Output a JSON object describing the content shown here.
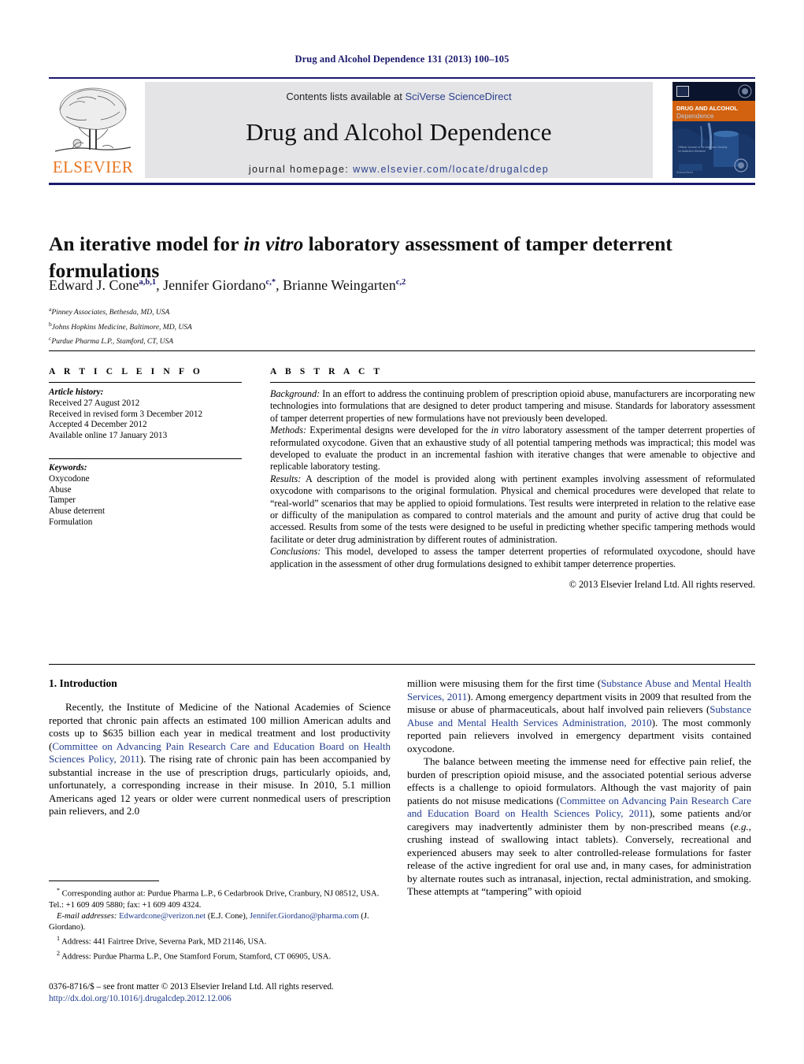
{
  "running_head": "Drug and Alcohol Dependence 131 (2013) 100–105",
  "masthead": {
    "contents_prefix": "Contents lists available at ",
    "contents_link": "SciVerse ScienceDirect",
    "journal_name": "Drug and Alcohol Dependence",
    "homepage_label": "journal homepage: ",
    "homepage_url": "www.elsevier.com/locate/drugalcdep",
    "publisher_name": "ELSEVIER",
    "cover_title_line1": "DRUG AND ALCOHOL",
    "cover_title_line2": "Dependence",
    "accent_orange": "#E87722",
    "accent_navy": "#1a1a6e",
    "link_blue": "#2b3f8c"
  },
  "article": {
    "title_part1": "An iterative model for ",
    "title_italic": "in vitro",
    "title_part2": " laboratory assessment of tamper deterrent formulations",
    "authors": [
      {
        "name": "Edward J. Cone",
        "sup": "a,b,1"
      },
      {
        "name": "Jennifer Giordano",
        "sup": "c,*"
      },
      {
        "name": "Brianne Weingarten",
        "sup": "c,2"
      }
    ],
    "affiliations": [
      {
        "marker": "a",
        "text": "Pinney Associates, Bethesda, MD, USA"
      },
      {
        "marker": "b",
        "text": "Johns Hopkins Medicine, Baltimore, MD, USA"
      },
      {
        "marker": "c",
        "text": "Purdue Pharma L.P., Stamford, CT, USA"
      }
    ]
  },
  "article_info": {
    "heading": "A R T I C L E   I N F O",
    "history_label": "Article history:",
    "history": [
      "Received 27 August 2012",
      "Received in revised form 3 December 2012",
      "Accepted 4 December 2012",
      "Available online 17 January 2013"
    ],
    "keywords_label": "Keywords:",
    "keywords": [
      "Oxycodone",
      "Abuse",
      "Tamper",
      "Abuse deterrent",
      "Formulation"
    ]
  },
  "abstract": {
    "heading": "A B S T R A C T",
    "background_label": "Background:",
    "background_text": " In an effort to address the continuing problem of prescription opioid abuse, manufacturers are incorporating new technologies into formulations that are designed to deter product tampering and misuse. Standards for laboratory assessment of tamper deterrent properties of new formulations have not previously been developed.",
    "methods_label": "Methods:",
    "methods_text_1": " Experimental designs were developed for the ",
    "methods_italic": "in vitro",
    "methods_text_2": " laboratory assessment of the tamper deterrent properties of reformulated oxycodone. Given that an exhaustive study of all potential tampering methods was impractical; this model was developed to evaluate the product in an incremental fashion with iterative changes that were amenable to objective and replicable laboratory testing.",
    "results_label": "Results:",
    "results_text": " A description of the model is provided along with pertinent examples involving assessment of reformulated oxycodone with comparisons to the original formulation. Physical and chemical procedures were developed that relate to “real-world” scenarios that may be applied to opioid formulations. Test results were interpreted in relation to the relative ease or difficulty of the manipulation as compared to control materials and the amount and purity of active drug that could be accessed. Results from some of the tests were designed to be useful in predicting whether specific tampering methods would facilitate or deter drug administration by different routes of administration.",
    "conclusions_label": "Conclusions:",
    "conclusions_text": " This model, developed to assess the tamper deterrent properties of reformulated oxycodone, should have application in the assessment of other drug formulations designed to exhibit tamper deterrence properties.",
    "copyright": "© 2013 Elsevier Ireland Ltd. All rights reserved."
  },
  "body": {
    "section_heading": "1. Introduction",
    "left_p1_a": "Recently, the Institute of Medicine of the National Academies of Science reported that chronic pain affects an estimated 100 million American adults and costs up to $635 billion each year in medical treatment and lost productivity (",
    "left_p1_ref1": "Committee on Advancing Pain Research Care and Education Board on Health Sciences Policy, 2011",
    "left_p1_b": "). The rising rate of chronic pain has been accompanied by substantial increase in the use of prescription drugs, particularly opioids, and, unfortunately, a corresponding increase in their misuse. In 2010, 5.1 million Americans aged 12 years or older were current nonmedical users of prescription pain relievers, and 2.0",
    "right_p1_a": "million were misusing them for the first time (",
    "right_p1_ref1": "Substance Abuse and Mental Health Services, 2011",
    "right_p1_b": "). Among emergency department visits in 2009 that resulted from the misuse or abuse of pharmaceuticals, about half involved pain relievers (",
    "right_p1_ref2": "Substance Abuse and Mental Health Services Administration, 2010",
    "right_p1_c": "). The most commonly reported pain relievers involved in emergency department visits contained oxycodone.",
    "right_p2_a": "The balance between meeting the immense need for effective pain relief, the burden of prescription opioid misuse, and the associated potential serious adverse effects is a challenge to opioid formulators. Although the vast majority of pain patients do not misuse medications (",
    "right_p2_ref1": "Committee on Advancing Pain Research Care and Education Board on Health Sciences Policy, 2011",
    "right_p2_b": "), some patients and/or caregivers may inadvertently administer them by non-prescribed means (",
    "right_p2_italic": "e.g.",
    "right_p2_c": ", crushing instead of swallowing intact tablets). Conversely, recreational and experienced abusers may seek to alter controlled-release formulations for faster release of the active ingredient for oral use and, in many cases, for administration by alternate routes such as intranasal, injection, rectal administration, and smoking. These attempts at “tampering” with opioid"
  },
  "footnotes": {
    "corresponding_marker": "*",
    "corresponding_text": " Corresponding author at: Purdue Pharma L.P., 6 Cedarbrook Drive, Cranbury, NJ 08512, USA. Tel.: +1 609 409 5880; fax: +1 609 409 4324.",
    "email_label": "E-mail addresses:",
    "email_1": "Edwardcone@verizon.net",
    "email_1_who": " (E.J. Cone),",
    "email_2": "Jennifer.Giordano@pharma.com",
    "email_2_who": " (J. Giordano).",
    "note1_marker": "1",
    "note1_text": " Address: 441 Fairtree Drive, Severna Park, MD 21146, USA.",
    "note2_marker": "2",
    "note2_text": " Address: Purdue Pharma L.P., One Stamford Forum, Stamford, CT 06905, USA."
  },
  "issn": {
    "line1": "0376-8716/$ – see front matter © 2013 Elsevier Ireland Ltd. All rights reserved.",
    "doi": "http://dx.doi.org/10.1016/j.drugalcdep.2012.12.006"
  }
}
